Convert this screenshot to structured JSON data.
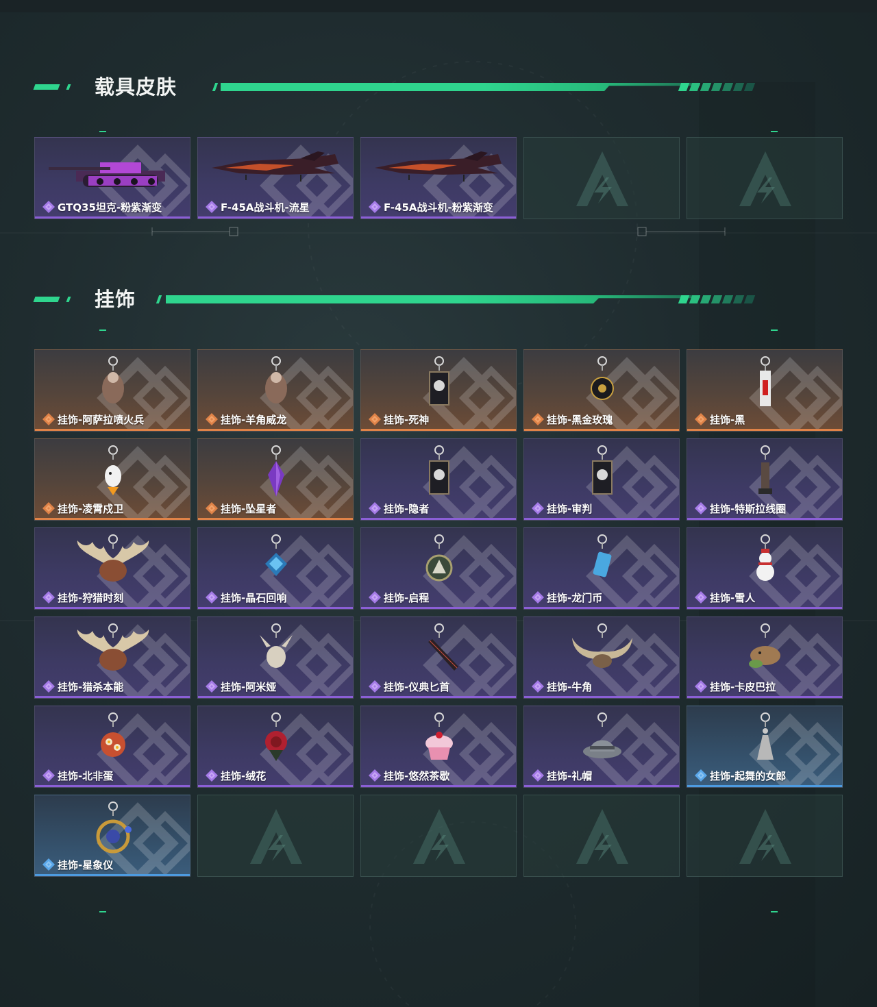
{
  "colors": {
    "accent_green": "#2fd58e",
    "rarity_purple": "#8b5fd6",
    "rarity_orange": "#e08348",
    "rarity_blue": "#4d9be0"
  },
  "sections": [
    {
      "title": "载具皮肤",
      "items": [
        {
          "label": "GTQ35坦克-粉紫渐变",
          "rarity": "purple",
          "icon": "tank-skin-icon"
        },
        {
          "label": "F-45A战斗机-流星",
          "rarity": "purple",
          "icon": "fighter-jet-skin-icon"
        },
        {
          "label": "F-45A战斗机-粉紫渐变",
          "rarity": "purple",
          "icon": "fighter-jet-skin-icon"
        },
        {
          "label": "",
          "rarity": "empty",
          "icon": "brand-watermark-icon"
        },
        {
          "label": "",
          "rarity": "empty",
          "icon": "brand-watermark-icon"
        }
      ]
    },
    {
      "title": "挂饰",
      "items": [
        {
          "label": "挂饰-阿萨拉喷火兵",
          "rarity": "orange",
          "icon": "flamethrower-soldier-charm-icon"
        },
        {
          "label": "挂饰-羊角威龙",
          "rarity": "orange",
          "icon": "ram-dragon-charm-icon"
        },
        {
          "label": "挂饰-死神",
          "rarity": "orange",
          "icon": "reaper-card-charm-icon"
        },
        {
          "label": "挂饰-黑金玫瑰",
          "rarity": "orange",
          "icon": "black-gold-rose-charm-icon"
        },
        {
          "label": "挂饰-黑",
          "rarity": "orange",
          "icon": "black-tag-charm-icon"
        },
        {
          "label": "挂饰-凌霄戍卫",
          "rarity": "orange",
          "icon": "eagle-guard-charm-icon"
        },
        {
          "label": "挂饰-坠星者",
          "rarity": "orange",
          "icon": "purple-crystal-charm-icon"
        },
        {
          "label": "挂饰-隐者",
          "rarity": "purple",
          "icon": "hermit-card-charm-icon"
        },
        {
          "label": "挂饰-审判",
          "rarity": "purple",
          "icon": "judgement-card-charm-icon"
        },
        {
          "label": "挂饰-特斯拉线圈",
          "rarity": "purple",
          "icon": "tesla-coil-charm-icon"
        },
        {
          "label": "挂饰-狩猎时刻",
          "rarity": "purple",
          "icon": "moose-antler-charm-icon"
        },
        {
          "label": "挂饰-晶石回响",
          "rarity": "purple",
          "icon": "blue-crystal-charm-icon"
        },
        {
          "label": "挂饰-启程",
          "rarity": "purple",
          "icon": "emblem-medal-charm-icon"
        },
        {
          "label": "挂饰-龙门币",
          "rarity": "purple",
          "icon": "coin-card-charm-icon"
        },
        {
          "label": "挂饰-雪人",
          "rarity": "purple",
          "icon": "snowman-charm-icon"
        },
        {
          "label": "挂饰-猎杀本能",
          "rarity": "purple",
          "icon": "moose-antler-charm-icon"
        },
        {
          "label": "挂饰-阿米娅",
          "rarity": "purple",
          "icon": "rabbit-charm-icon"
        },
        {
          "label": "挂饰-仪典匕首",
          "rarity": "purple",
          "icon": "dagger-charm-icon"
        },
        {
          "label": "挂饰-牛角",
          "rarity": "purple",
          "icon": "bull-horn-charm-icon"
        },
        {
          "label": "挂饰-卡皮巴拉",
          "rarity": "purple",
          "icon": "capybara-charm-icon"
        },
        {
          "label": "挂饰-北非蛋",
          "rarity": "purple",
          "icon": "shakshuka-charm-icon"
        },
        {
          "label": "挂饰-绒花",
          "rarity": "purple",
          "icon": "red-flower-charm-icon"
        },
        {
          "label": "挂饰-悠然茶歇",
          "rarity": "purple",
          "icon": "cupcake-charm-icon"
        },
        {
          "label": "挂饰-礼帽",
          "rarity": "purple",
          "icon": "fedora-hat-charm-icon"
        },
        {
          "label": "挂饰-起舞的女郎",
          "rarity": "blue",
          "icon": "dancing-lady-charm-icon"
        },
        {
          "label": "挂饰-星象仪",
          "rarity": "blue",
          "icon": "astrolabe-charm-icon"
        },
        {
          "label": "",
          "rarity": "empty",
          "icon": "brand-watermark-icon"
        },
        {
          "label": "",
          "rarity": "empty",
          "icon": "brand-watermark-icon"
        },
        {
          "label": "",
          "rarity": "empty",
          "icon": "brand-watermark-icon"
        },
        {
          "label": "",
          "rarity": "empty",
          "icon": "brand-watermark-icon"
        }
      ]
    }
  ]
}
